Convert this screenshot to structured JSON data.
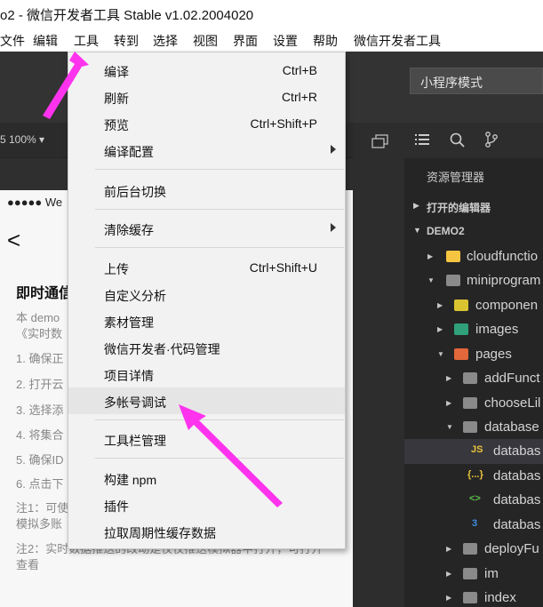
{
  "window": {
    "title": "o2 - 微信开发者工具 Stable v1.02.2004020"
  },
  "menubar": {
    "items": [
      "文件",
      "编辑",
      "工具",
      "转到",
      "选择",
      "视图",
      "界面",
      "设置",
      "帮助",
      "微信开发者工具"
    ]
  },
  "toolbar": {
    "mode": "小程序模式"
  },
  "simulator": {
    "zoom": "5 100% ▾",
    "status": "●●●●● We",
    "back": "<",
    "title": "即时通信",
    "lines": [
      "本 demo",
      "《实时数",
      "1. 确保正",
      "2. 打开云",
      "3. 选择添",
      "4. 将集合",
      "5. 确保ID",
      "6. 点击下",
      "注1：可使",
      "模拟多账",
      "注2：实时数据推送的改动是仅仅推送模拟器中打开，可打开",
      "查看"
    ]
  },
  "dropdown": {
    "items": [
      {
        "label": "编译",
        "shortcut": "Ctrl+B"
      },
      {
        "label": "刷新",
        "shortcut": "Ctrl+R"
      },
      {
        "label": "预览",
        "shortcut": "Ctrl+Shift+P"
      },
      {
        "label": "编译配置",
        "shortcut": ""
      },
      {
        "label": "前后台切换",
        "shortcut": ""
      },
      {
        "label": "清除缓存",
        "shortcut": ""
      },
      {
        "label": "上传",
        "shortcut": "Ctrl+Shift+U"
      },
      {
        "label": "自定义分析",
        "shortcut": ""
      },
      {
        "label": "素材管理",
        "shortcut": ""
      },
      {
        "label": "微信开发者·代码管理",
        "shortcut": ""
      },
      {
        "label": "项目详情",
        "shortcut": ""
      },
      {
        "label": "多帐号调试",
        "shortcut": ""
      },
      {
        "label": "工具栏管理",
        "shortcut": ""
      },
      {
        "label": "构建 npm",
        "shortcut": ""
      },
      {
        "label": "插件",
        "shortcut": ""
      },
      {
        "label": "拉取周期性缓存数据",
        "shortcut": ""
      }
    ]
  },
  "explorer": {
    "title": "资源管理器",
    "open_editors": "打开的编辑器",
    "project": "DEMO2",
    "tree": [
      {
        "name": "cloudfunctio"
      },
      {
        "name": "miniprogram"
      },
      {
        "name": "componen"
      },
      {
        "name": "images"
      },
      {
        "name": "pages"
      },
      {
        "name": "addFunct"
      },
      {
        "name": "chooseLil"
      },
      {
        "name": "database"
      },
      {
        "name": "databas",
        "badge": "JS"
      },
      {
        "name": "databas",
        "badge": "{...}"
      },
      {
        "name": "databas",
        "badge": "<>"
      },
      {
        "name": "databas",
        "badge": "3"
      },
      {
        "name": "deployFu"
      },
      {
        "name": "im"
      },
      {
        "name": "index"
      }
    ]
  },
  "colors": {
    "highlight_arrow": "#ff33ee",
    "dark_bg": "#252526",
    "menu_bg": "#f2f2f2"
  }
}
